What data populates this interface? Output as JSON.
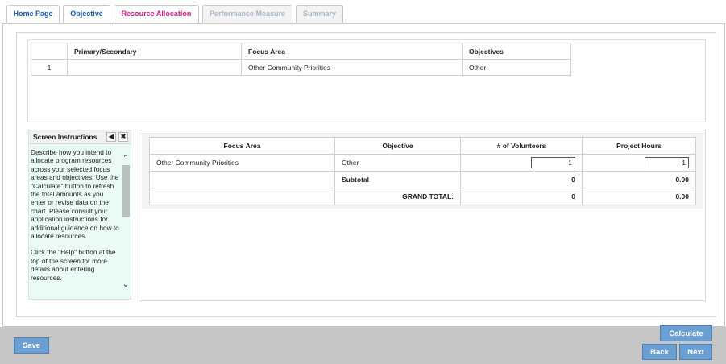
{
  "tabs": [
    {
      "label": "Home Page"
    },
    {
      "label": "Objective"
    },
    {
      "label": "Resource Allocation"
    },
    {
      "label": "Performance Measure"
    },
    {
      "label": "Summary"
    }
  ],
  "focus_table": {
    "headers": [
      "",
      "Primary/Secondary",
      "Focus Area",
      "Objectives"
    ],
    "rows": [
      {
        "num": "1",
        "primary": "",
        "focus_area": "Other Community Priorities",
        "objective": "Other"
      }
    ]
  },
  "instructions": {
    "title": "Screen Instructions",
    "para1": "Describe how you intend to allocate program resources across your selected focus areas and objectives. Use the \"Calculate\" button to refresh the total amounts as you enter or revise data on the chart. Please consult your application instructions for additional guidance on how to allocate resources.",
    "para2": "Click the \"Help\" button at the top of the screen for more details about entering resources."
  },
  "resource_table": {
    "headers": [
      "Focus Area",
      "Objective",
      "# of Volunteers",
      "Project Hours"
    ],
    "row": {
      "focus_area": "Other Community Priorities",
      "objective": "Other",
      "volunteers": "1",
      "hours": "1"
    },
    "subtotal": {
      "label": "Subtotal",
      "volunteers": "0",
      "hours": "0.00"
    },
    "grand_total": {
      "label": "GRAND TOTAL:",
      "volunteers": "0",
      "hours": "0.00"
    }
  },
  "buttons": {
    "save": "Save",
    "calculate": "Calculate",
    "back": "Back",
    "next": "Next"
  },
  "icons": {
    "collapse": "chevron-left-icon",
    "close": "close-icon",
    "scroll_up": "chevron-up-icon",
    "scroll_down": "chevron-down-icon"
  }
}
